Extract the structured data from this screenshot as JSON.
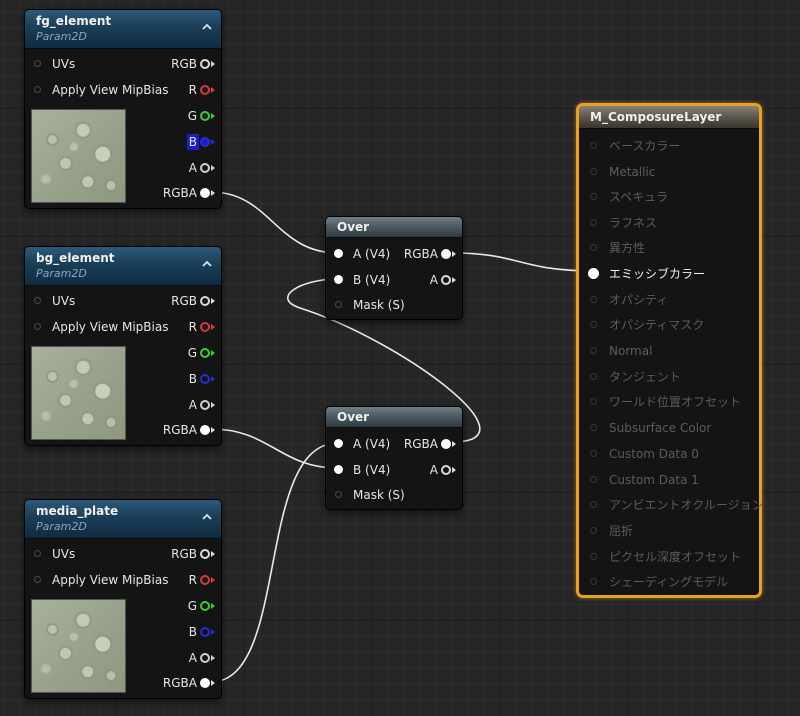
{
  "colors": {
    "pin_white": "#dcdcdc",
    "pin_red": "#d83a3a",
    "pin_green": "#35d035",
    "pin_blue": "#2a2ad8",
    "pin_alpha": "#cfcfcf",
    "material_border": "#e8a21c",
    "wire": "#e8e8e8"
  },
  "param_nodes": [
    {
      "title": "fg_element",
      "subtitle": "Param2D",
      "collapse_icon": "chevron-up-icon",
      "inputs": [
        "UVs",
        "Apply View MipBias"
      ],
      "outputs": [
        "RGB",
        "R",
        "G",
        "B",
        "A",
        "RGBA"
      ]
    },
    {
      "title": "bg_element",
      "subtitle": "Param2D",
      "collapse_icon": "chevron-up-icon",
      "inputs": [
        "UVs",
        "Apply View MipBias"
      ],
      "outputs": [
        "RGB",
        "R",
        "G",
        "B",
        "A",
        "RGBA"
      ]
    },
    {
      "title": "media_plate",
      "subtitle": "Param2D",
      "collapse_icon": "chevron-up-icon",
      "inputs": [
        "UVs",
        "Apply View MipBias"
      ],
      "outputs": [
        "RGB",
        "R",
        "G",
        "B",
        "A",
        "RGBA"
      ]
    }
  ],
  "over_nodes": [
    {
      "title": "Over",
      "inputs": [
        "A (V4)",
        "B (V4)",
        "Mask (S)"
      ],
      "outputs": [
        "RGBA",
        "A"
      ]
    },
    {
      "title": "Over",
      "inputs": [
        "A (V4)",
        "B (V4)",
        "Mask (S)"
      ],
      "outputs": [
        "RGBA",
        "A"
      ]
    }
  ],
  "material_node": {
    "title": "M_ComposureLayer",
    "pins": [
      "ベースカラー",
      "Metallic",
      "スペキュラ",
      "ラフネス",
      "異方性",
      "エミッシブカラー",
      "オパシティ",
      "オパシティマスク",
      "Normal",
      "タンジェント",
      "ワールド位置オフセット",
      "Subsurface Color",
      "Custom Data 0",
      "Custom Data 1",
      "アンビエントオクルージョン",
      "屈折",
      "ピクセル深度オフセット",
      "シェーディングモデル"
    ],
    "connected_pin": "エミッシブカラー"
  }
}
